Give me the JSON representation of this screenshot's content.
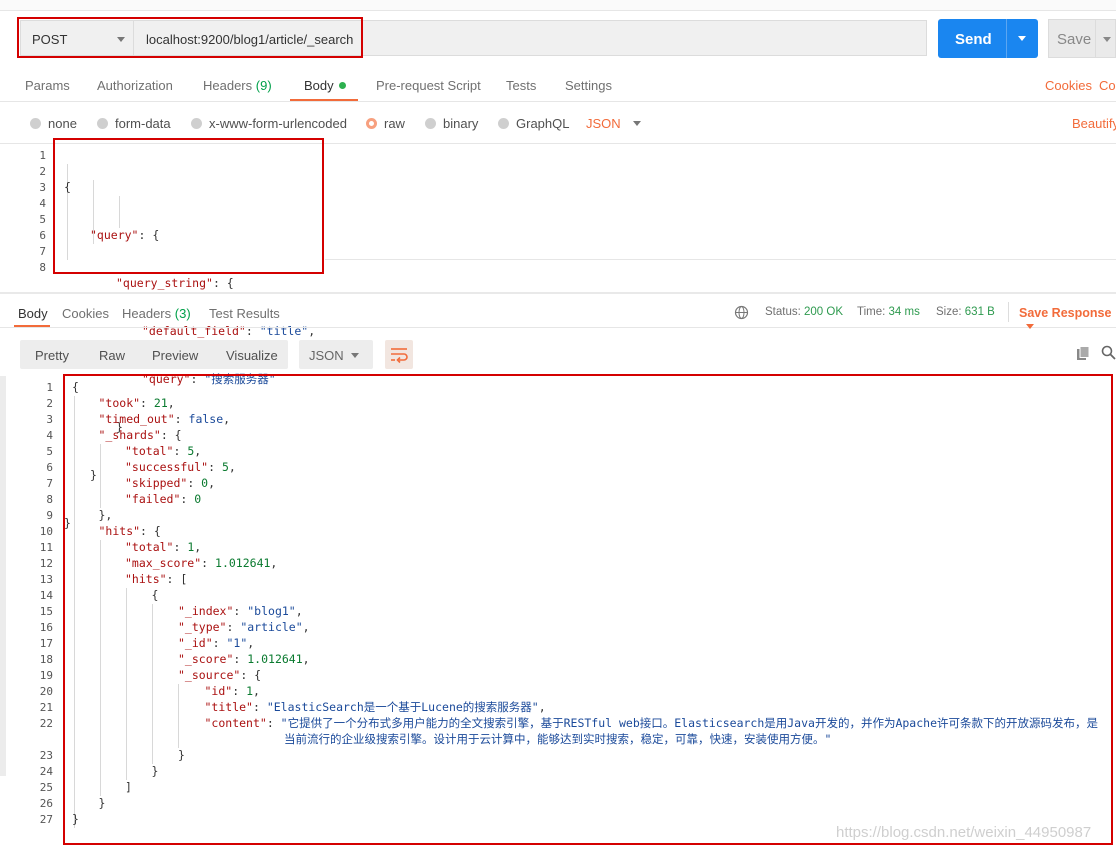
{
  "request": {
    "method": "POST",
    "url": "localhost:9200/blog1/article/_search",
    "send_label": "Send",
    "save_label": "Save"
  },
  "request_tabs": {
    "params": "Params",
    "authorization": "Authorization",
    "headers": "Headers",
    "headers_count": "(9)",
    "body": "Body",
    "prerequest": "Pre-request Script",
    "tests": "Tests",
    "settings": "Settings",
    "cookies": "Cookies",
    "code": "Code"
  },
  "body_types": {
    "none": "none",
    "form_data": "form-data",
    "urlencoded": "x-www-form-urlencoded",
    "raw": "raw",
    "binary": "binary",
    "graphql": "GraphQL",
    "json": "JSON",
    "beautify": "Beautify"
  },
  "request_body": {
    "line_numbers": [
      "1",
      "2",
      "3",
      "4",
      "5",
      "6",
      "7",
      "8"
    ],
    "l1": "{",
    "l2_key": "\"query\"",
    "l2_rest": ": {",
    "l3_key": "\"query_string\"",
    "l3_rest": ": {",
    "l4_key": "\"default_field\"",
    "l4_sep": ": ",
    "l4_val": "\"title\"",
    "l4_end": ",",
    "l5_key": "\"query\"",
    "l5_sep": ": ",
    "l5_val": "\"搜索服务器\"",
    "l6": "}",
    "l7": "}",
    "l8": "}"
  },
  "response_tabs": {
    "body": "Body",
    "cookies": "Cookies",
    "headers": "Headers",
    "headers_count": "(3)",
    "test_results": "Test Results"
  },
  "response_status": {
    "status_label": "Status:",
    "status_value": "200 OK",
    "time_label": "Time:",
    "time_value": "34 ms",
    "size_label": "Size:",
    "size_value": "631 B",
    "save_response": "Save Response"
  },
  "view_modes": {
    "pretty": "Pretty",
    "raw": "Raw",
    "preview": "Preview",
    "visualize": "Visualize",
    "format": "JSON"
  },
  "response_body": {
    "line_numbers": [
      "1",
      "2",
      "3",
      "4",
      "5",
      "6",
      "7",
      "8",
      "9",
      "10",
      "11",
      "12",
      "13",
      "14",
      "15",
      "16",
      "17",
      "18",
      "19",
      "20",
      "21",
      "22",
      "",
      "23",
      "24",
      "25",
      "26",
      "27"
    ],
    "lines": [
      {
        "k": "",
        "sep": "",
        "v": "{",
        "vclass": ""
      },
      {
        "k": "\"took\"",
        "sep": ": ",
        "v": "21",
        "vclass": "n",
        "end": ","
      },
      {
        "k": "\"timed_out\"",
        "sep": ": ",
        "v": "false",
        "vclass": "kw",
        "end": ","
      },
      {
        "k": "\"_shards\"",
        "sep": ": {",
        "v": "",
        "vclass": ""
      },
      {
        "k": "\"total\"",
        "sep": ": ",
        "v": "5",
        "vclass": "n",
        "end": ","
      },
      {
        "k": "\"successful\"",
        "sep": ": ",
        "v": "5",
        "vclass": "n",
        "end": ","
      },
      {
        "k": "\"skipped\"",
        "sep": ": ",
        "v": "0",
        "vclass": "n",
        "end": ","
      },
      {
        "k": "\"failed\"",
        "sep": ": ",
        "v": "0",
        "vclass": "n"
      },
      {
        "k": "",
        "sep": "",
        "v": "},",
        "vclass": ""
      },
      {
        "k": "\"hits\"",
        "sep": ": {",
        "v": "",
        "vclass": ""
      },
      {
        "k": "\"total\"",
        "sep": ": ",
        "v": "1",
        "vclass": "n",
        "end": ","
      },
      {
        "k": "\"max_score\"",
        "sep": ": ",
        "v": "1.012641",
        "vclass": "n",
        "end": ","
      },
      {
        "k": "\"hits\"",
        "sep": ": [",
        "v": "",
        "vclass": ""
      },
      {
        "k": "",
        "sep": "",
        "v": "{",
        "vclass": ""
      },
      {
        "k": "\"_index\"",
        "sep": ": ",
        "v": "\"blog1\"",
        "vclass": "s",
        "end": ","
      },
      {
        "k": "\"_type\"",
        "sep": ": ",
        "v": "\"article\"",
        "vclass": "s",
        "end": ","
      },
      {
        "k": "\"_id\"",
        "sep": ": ",
        "v": "\"1\"",
        "vclass": "s",
        "end": ","
      },
      {
        "k": "\"_score\"",
        "sep": ": ",
        "v": "1.012641",
        "vclass": "n",
        "end": ","
      },
      {
        "k": "\"_source\"",
        "sep": ": {",
        "v": "",
        "vclass": ""
      },
      {
        "k": "\"id\"",
        "sep": ": ",
        "v": "1",
        "vclass": "n",
        "end": ","
      },
      {
        "k": "\"title\"",
        "sep": ": ",
        "v": "\"ElasticSearch是一个基于Lucene的搜索服务器\"",
        "vclass": "s",
        "end": ","
      },
      {
        "k": "\"content\"",
        "sep": ": ",
        "v": "\"它提供了一个分布式多用户能力的全文搜索引擎，基于RESTful web接口。Elasticsearch是用Java开发的，并作为Apache许可条款下的开放源码发布，是",
        "vclass": "s"
      },
      {
        "k": "",
        "sep": "",
        "v": "当前流行的企业级搜索引擎。设计用于云计算中，能够达到实时搜索，稳定，可靠，快速，安装使用方便。\"",
        "vclass": "s"
      },
      {
        "k": "",
        "sep": "",
        "v": "}",
        "vclass": ""
      },
      {
        "k": "",
        "sep": "",
        "v": "}",
        "vclass": ""
      },
      {
        "k": "",
        "sep": "",
        "v": "]",
        "vclass": ""
      },
      {
        "k": "",
        "sep": "",
        "v": "}",
        "vclass": ""
      },
      {
        "k": "",
        "sep": "",
        "v": "}",
        "vclass": ""
      }
    ]
  },
  "watermark": "https://blog.csdn.net/weixin_44950987",
  "colors": {
    "accent": "#f26b3a",
    "send": "#1a86f0",
    "status_ok": "#2e9a4f",
    "highlight_box": "#d40000"
  }
}
